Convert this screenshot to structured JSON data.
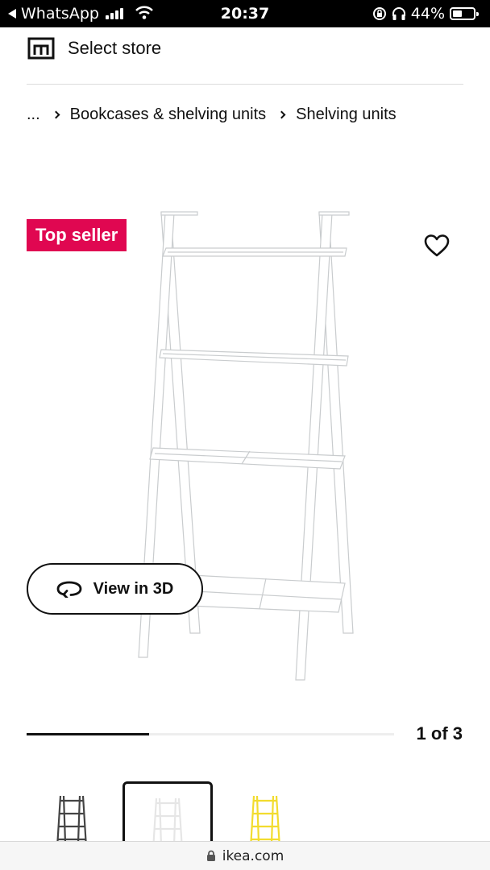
{
  "status_bar": {
    "back_app": "WhatsApp",
    "time": "20:37",
    "battery": "44%",
    "battery_level": 0.44
  },
  "store": {
    "label": "Select store"
  },
  "breadcrumb": {
    "ellipsis": "...",
    "items": [
      "Bookcases & shelving units",
      "Shelving units"
    ]
  },
  "product": {
    "badge": "Top seller",
    "badge_color": "#e00751",
    "favorite_icon": "heart-outline-icon",
    "view_3d_label": "View in 3D",
    "view_3d_icon": "rotate-icon"
  },
  "gallery": {
    "counter": "1 of 3",
    "progress": 0.333,
    "thumbnails": [
      {
        "color_name": "black",
        "color": "#444444",
        "selected": false
      },
      {
        "color_name": "white",
        "color": "#e6e6e6",
        "selected": true
      },
      {
        "color_name": "yellow",
        "color": "#f2dc2e",
        "selected": false
      }
    ]
  },
  "browser": {
    "url": "ikea.com",
    "lock_icon": "lock-icon"
  }
}
